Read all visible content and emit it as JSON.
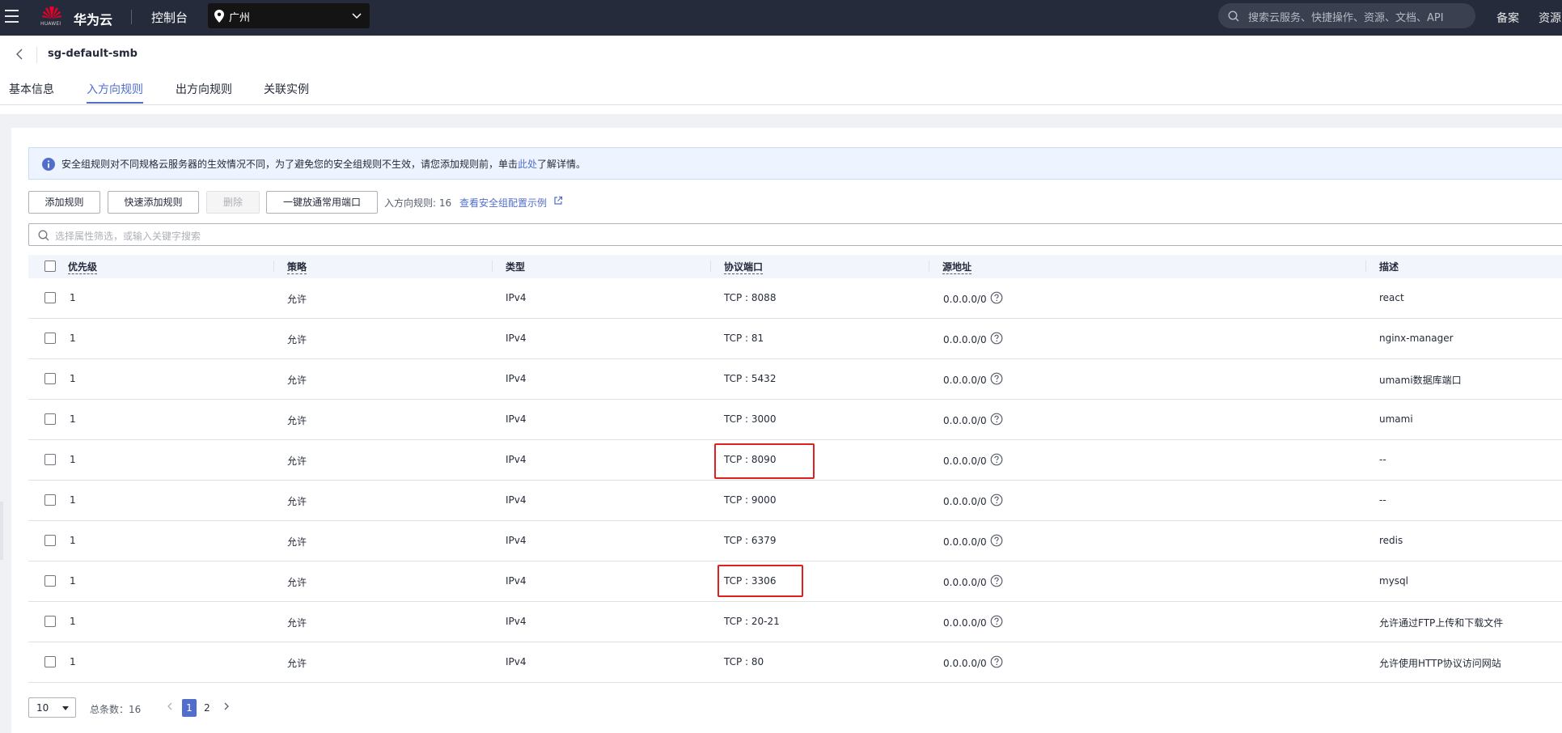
{
  "topbar": {
    "brand": "华为云",
    "logo_text": "HUAWEI",
    "console": "控制台",
    "region": "广州",
    "search_placeholder": "搜索云服务、快捷操作、资源、文档、API",
    "links": [
      "备案",
      "资源"
    ],
    "bg_color": "#252b3a"
  },
  "header": {
    "title": "sg-default-smb",
    "tabs": [
      {
        "label": "基本信息",
        "active": false
      },
      {
        "label": "入方向规则",
        "active": true
      },
      {
        "label": "出方向规则",
        "active": false
      },
      {
        "label": "关联实例",
        "active": false
      }
    ]
  },
  "notice": {
    "text_before": "安全组规则对不同规格云服务器的生效情况不同，为了避免您的安全组规则不生效，请您添加规则前，单击",
    "link": "此处",
    "text_after": "了解详情。"
  },
  "toolbar": {
    "add_rule": "添加规则",
    "quick_add": "快速添加规则",
    "delete": "删除",
    "open_ports": "一键放通常用端口",
    "rule_count": "入方向规则: 16",
    "example_link": "查看安全组配置示例"
  },
  "filter": {
    "placeholder": "选择属性筛选，或输入关键字搜索"
  },
  "table": {
    "columns": [
      "优先级",
      "策略",
      "类型",
      "协议端口",
      "源地址",
      "描述"
    ],
    "rows": [
      {
        "priority": "1",
        "policy": "允许",
        "type": "IPv4",
        "port": "TCP : 8088",
        "source": "0.0.0.0/0",
        "desc": "react",
        "highlighted": false
      },
      {
        "priority": "1",
        "policy": "允许",
        "type": "IPv4",
        "port": "TCP : 81",
        "source": "0.0.0.0/0",
        "desc": "nginx-manager",
        "highlighted": false
      },
      {
        "priority": "1",
        "policy": "允许",
        "type": "IPv4",
        "port": "TCP : 5432",
        "source": "0.0.0.0/0",
        "desc": "umami数据库端口",
        "highlighted": false
      },
      {
        "priority": "1",
        "policy": "允许",
        "type": "IPv4",
        "port": "TCP : 3000",
        "source": "0.0.0.0/0",
        "desc": "umami",
        "highlighted": false
      },
      {
        "priority": "1",
        "policy": "允许",
        "type": "IPv4",
        "port": "TCP : 8090",
        "source": "0.0.0.0/0",
        "desc": "--",
        "highlighted": true
      },
      {
        "priority": "1",
        "policy": "允许",
        "type": "IPv4",
        "port": "TCP : 9000",
        "source": "0.0.0.0/0",
        "desc": "--",
        "highlighted": false
      },
      {
        "priority": "1",
        "policy": "允许",
        "type": "IPv4",
        "port": "TCP : 6379",
        "source": "0.0.0.0/0",
        "desc": "redis",
        "highlighted": false
      },
      {
        "priority": "1",
        "policy": "允许",
        "type": "IPv4",
        "port": "TCP : 3306",
        "source": "0.0.0.0/0",
        "desc": "mysql",
        "highlighted": true
      },
      {
        "priority": "1",
        "policy": "允许",
        "type": "IPv4",
        "port": "TCP : 20-21",
        "source": "0.0.0.0/0",
        "desc": "允许通过FTP上传和下载文件",
        "highlighted": false
      },
      {
        "priority": "1",
        "policy": "允许",
        "type": "IPv4",
        "port": "TCP : 80",
        "source": "0.0.0.0/0",
        "desc": "允许使用HTTP协议访问网站",
        "highlighted": false
      }
    ]
  },
  "pagination": {
    "page_size": "10",
    "total": "总条数：16",
    "pages": [
      "1",
      "2"
    ],
    "current": "1"
  },
  "colors": {
    "accent": "#526ecc",
    "highlight_box": "#e02020",
    "header_bg": "#f2f5fc",
    "notice_bg": "#edf4ff"
  }
}
